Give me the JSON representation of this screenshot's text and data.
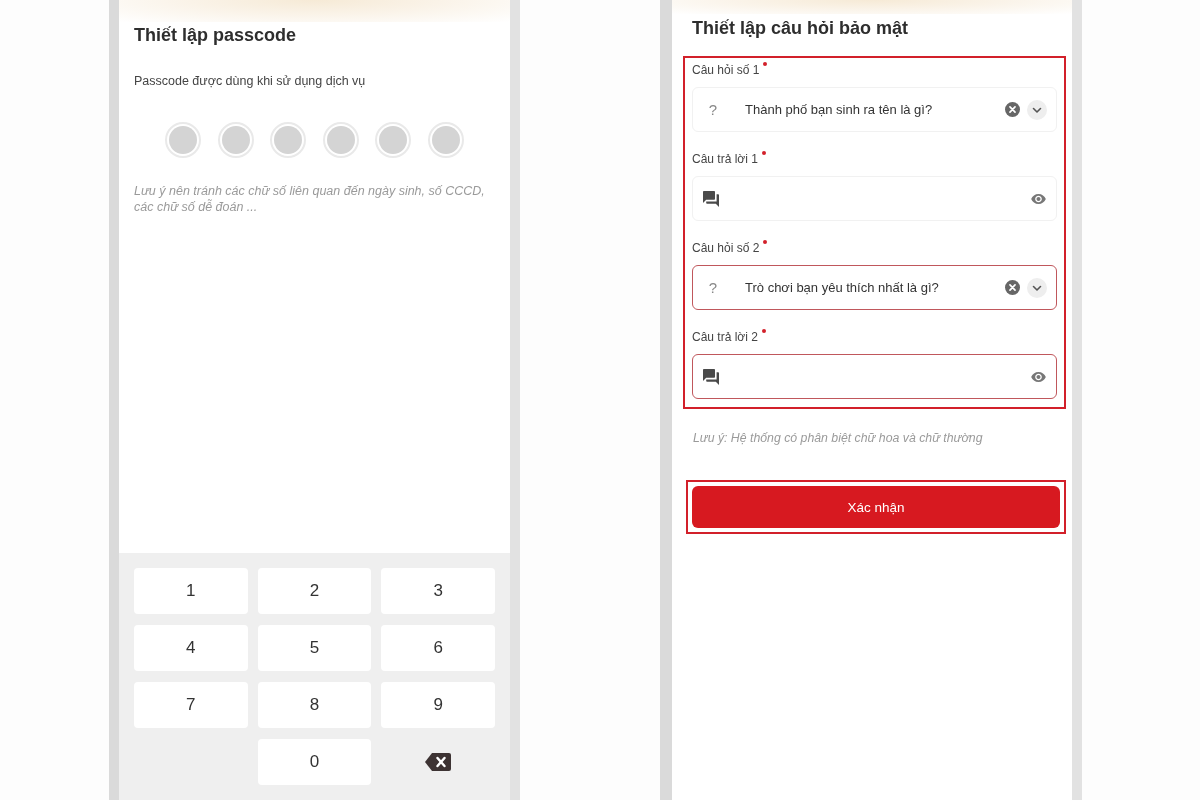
{
  "left_screen": {
    "title": "Thiết lập passcode",
    "subtitle": "Passcode được dùng khi sử dụng dịch vụ",
    "dots": [
      {
        "filled": false
      },
      {
        "filled": false
      },
      {
        "filled": false
      },
      {
        "filled": false
      },
      {
        "filled": false
      },
      {
        "filled": false
      }
    ],
    "note": "Lưu ý nên tránh các chữ số liên quan đến ngày sinh, số CCCD, các chữ số dễ đoán ...",
    "keypad": [
      {
        "kind": "digit",
        "label": "1"
      },
      {
        "kind": "digit",
        "label": "2"
      },
      {
        "kind": "digit",
        "label": "3"
      },
      {
        "kind": "digit",
        "label": "4"
      },
      {
        "kind": "digit",
        "label": "5"
      },
      {
        "kind": "digit",
        "label": "6"
      },
      {
        "kind": "digit",
        "label": "7"
      },
      {
        "kind": "digit",
        "label": "8"
      },
      {
        "kind": "digit",
        "label": "9"
      },
      {
        "kind": "blank"
      },
      {
        "kind": "digit",
        "label": "0"
      },
      {
        "kind": "backspace"
      }
    ]
  },
  "right_screen": {
    "title": "Thiết lập câu hỏi bảo mật",
    "form": {
      "highlighted": true,
      "fields": [
        {
          "kind": "select",
          "label": "Câu hỏi số 1",
          "required": true,
          "icon": "?",
          "value": "Thành phố bạn sinh ra tên là gì?",
          "highlighted": false
        },
        {
          "kind": "answer",
          "label": "Câu trả lời 1",
          "required": true,
          "highlighted": false
        },
        {
          "kind": "select",
          "label": "Câu hỏi số 2",
          "required": true,
          "icon": "?",
          "value": "Trò chơi bạn yêu thích nhất là gì?",
          "highlighted": true
        },
        {
          "kind": "answer",
          "label": "Câu trả lời 2",
          "required": true,
          "highlighted": true
        }
      ]
    },
    "note": "Lưu ý: Hệ thống có phân biệt chữ hoa và chữ thường",
    "confirm_button": {
      "label": "Xác nhận",
      "highlighted": true
    }
  }
}
